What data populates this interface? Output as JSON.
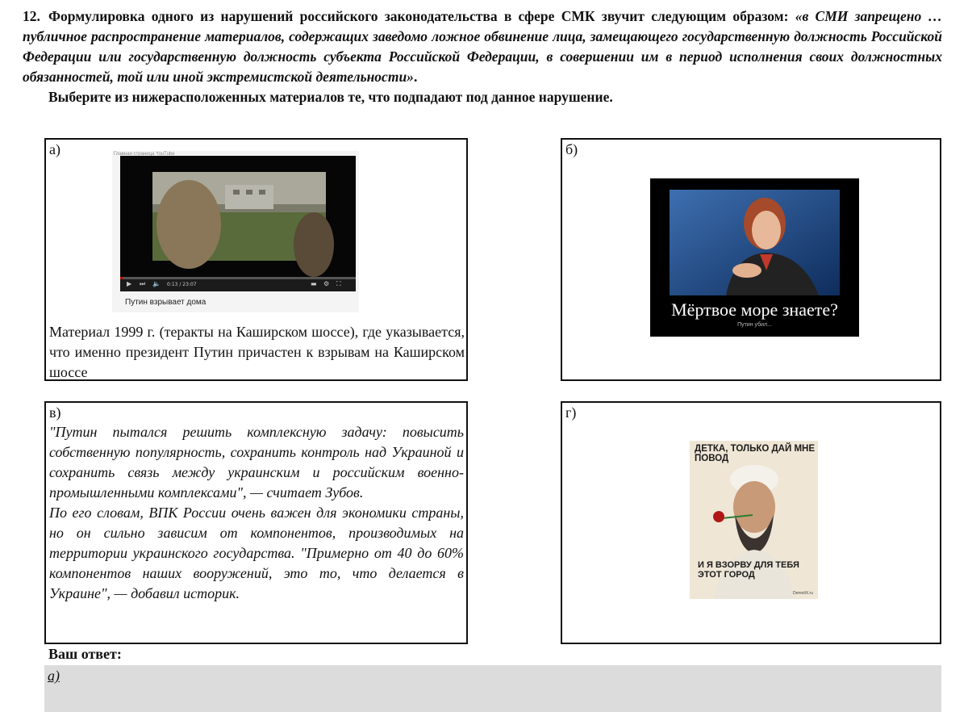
{
  "question": {
    "number": "12.",
    "intro": "Формулировка одного из нарушений российского законодательства в сфере СМК звучит следующим образом:",
    "quote": "«в СМИ запрещено … публичное распространение материалов, содержащих заведомо ложное обвинение лица, замещающего государственную должность Российской Федерации или государственную должность субъекта Российской Федерации, в совершении им в период исполнения своих должностных обязанностей, той или иной экстремистской деятельности»",
    "end": ".",
    "task": "Выберите из нижерасположенных материалов те, что подпадают под данное нарушение."
  },
  "options": {
    "a": {
      "letter": "а)",
      "video_topbar": "Главная страница YouTube",
      "video_time": "0:13 / 23:07",
      "video_progress": 0.01,
      "video_caption": "Путин взрывает дома",
      "description": "Материал 1999 г. (теракты на Каширском шоссе), где указывается, что именно президент Путин причастен к взрывам на Каширском шоссе"
    },
    "b": {
      "letter": "б)",
      "demot_title": "Мёртвое море знаете?",
      "demot_sub": "Путин убил..."
    },
    "v": {
      "letter": "в)",
      "para1": "\"Путин пытался решить комплексную задачу: повысить собственную популярность, сохранить контроль над Украиной и сохранить связь между украинским и российским военно-промышленными комплексами\", — считает Зубов.",
      "para2": "По его словам, ВПК России очень важен для экономики страны, но он сильно зависим от компонентов, производимых на территории украинского государства. \"Примерно от 40 до 60% компонентов наших вооружений, это то, что делается в Украине\", — добавил историк."
    },
    "g": {
      "letter": "г)",
      "poster_top": "ДЕТКА, ТОЛЬКО ДАЙ МНЕ ПОВОД",
      "poster_bottom": "И Я ВЗОРВУ ДЛЯ ТЕБЯ ЭТОТ ГОРОД",
      "poster_sign": "DemotiX.ru"
    }
  },
  "answer": {
    "label": "Ваш ответ:",
    "value": "а)"
  },
  "colors": {
    "border": "#111111",
    "answer_bg": "#dcdcdc",
    "progress": "#cc0000"
  }
}
